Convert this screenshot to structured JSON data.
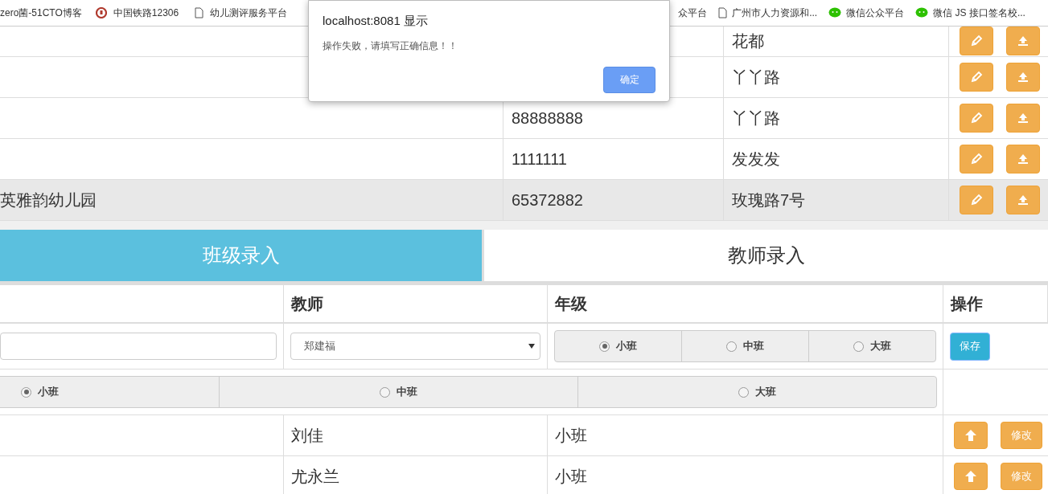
{
  "bookmarks": [
    {
      "label": "zero菌-51CTO博客",
      "kind": "none"
    },
    {
      "label": "中国铁路12306",
      "kind": "rail"
    },
    {
      "label": "幼儿测评服务平台",
      "kind": "page"
    },
    {
      "label": "众平台",
      "kind": "none"
    },
    {
      "label": "广州市人力资源和...",
      "kind": "page"
    },
    {
      "label": "微信公众平台",
      "kind": "wechat"
    },
    {
      "label": "微信 JS 接口签名校...",
      "kind": "wechat"
    }
  ],
  "dialog": {
    "title": "localhost:8081 显示",
    "message": "操作失败，请填写正确信息！！",
    "button": "确定"
  },
  "top_table": {
    "rows": [
      {
        "column_3": "花都",
        "highlighted": false
      },
      {
        "column_3": "丫丫路",
        "highlighted": false
      },
      {
        "column_2": "88888888",
        "column_3": "丫丫路",
        "highlighted": false
      },
      {
        "column_2": "1111111",
        "column_3": "发发发",
        "highlighted": false
      },
      {
        "column_1": "英雅韵幼儿园",
        "column_2": "65372882",
        "column_3": "玫瑰路7号",
        "highlighted": true
      }
    ]
  },
  "tabs": [
    {
      "label": "班级录入",
      "selected": true
    },
    {
      "label": "教师录入",
      "selected": false
    }
  ],
  "class_table": {
    "columns": [
      "教师",
      "年级",
      "操作"
    ],
    "form_row": {
      "teacher_select": "郑建福",
      "grade_options": [
        {
          "label": "小班",
          "selected": true
        },
        {
          "label": "中班",
          "selected": false
        },
        {
          "label": "大班",
          "selected": false
        }
      ],
      "save_button": "保存"
    },
    "grade_row": {
      "grade_options": [
        {
          "label": "小班",
          "selected": true
        },
        {
          "label": "中班",
          "selected": false
        },
        {
          "label": "大班",
          "selected": false
        }
      ]
    },
    "rows": [
      {
        "teacher": "刘佳",
        "grade": "小班",
        "edit_button": "修改"
      },
      {
        "teacher": "尤永兰",
        "grade": "小班",
        "edit_button": "修改"
      }
    ]
  }
}
